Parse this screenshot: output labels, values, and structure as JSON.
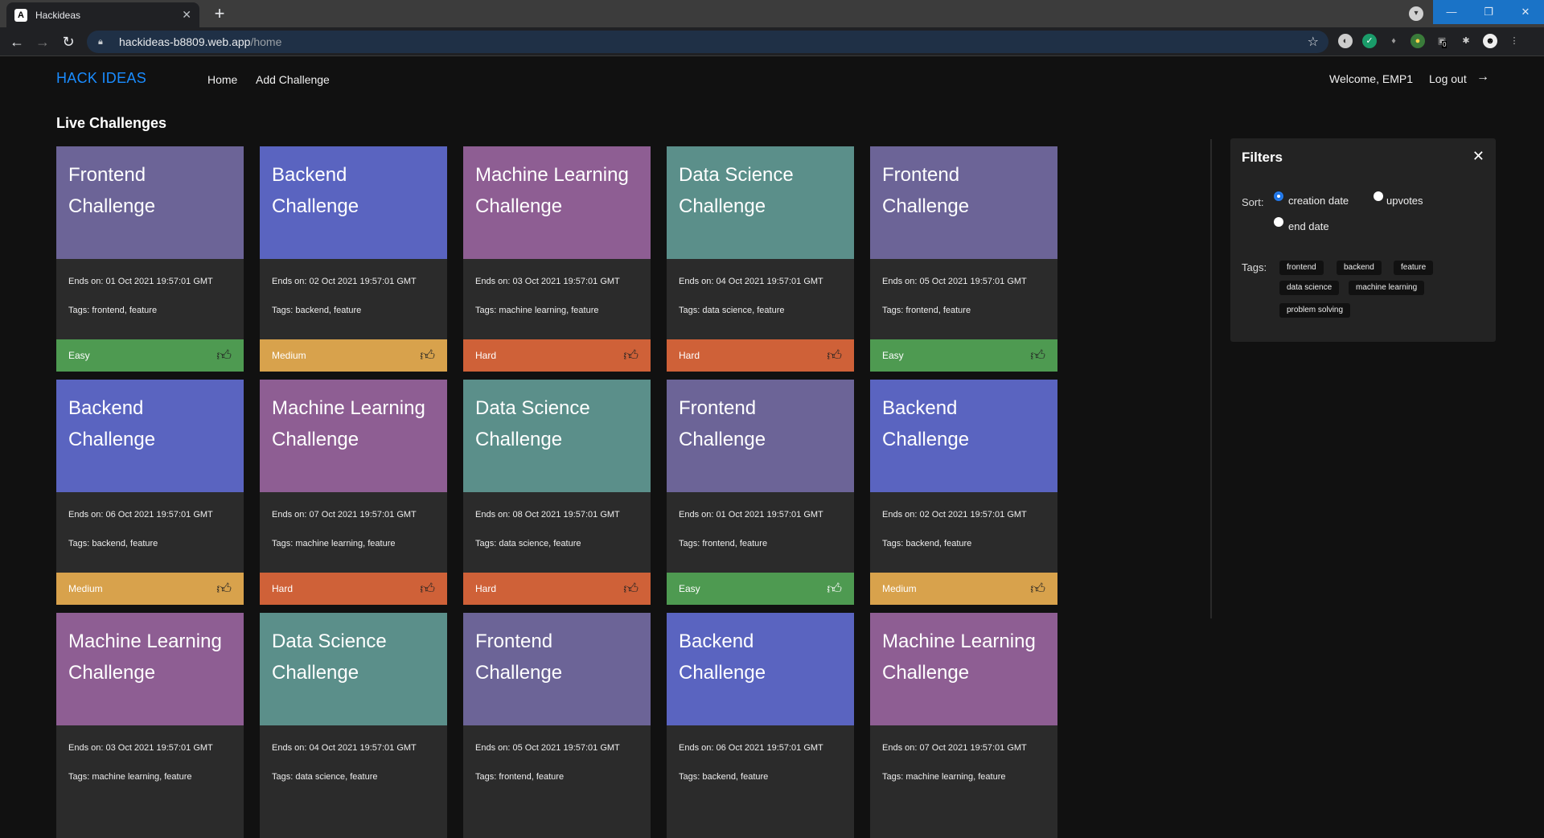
{
  "browser": {
    "tab_title": "Hackideas",
    "tab_favicon": "A",
    "url_host": "hackideas-b8809.web.app",
    "url_path": "/home",
    "ext_badge": "0"
  },
  "nav": {
    "brand": "HACK IDEAS",
    "home": "Home",
    "add_challenge": "Add Challenge",
    "welcome": "Welcome, EMP1",
    "logout": "Log out"
  },
  "section_title": "Live Challenges",
  "colors": {
    "frontend": "#6c6497",
    "backend": "#5a64c0",
    "machine_learning": "#8e5e93",
    "data_science": "#5b8f8a",
    "easy": "#4e9a51",
    "medium": "#d8a24c",
    "hard": "#cf6138"
  },
  "cards": [
    {
      "name": "Frontend Challenge",
      "cat": "frontend",
      "ends": "Ends on: 01 Oct 2021 19:57:01 GMT",
      "tags": "Tags: frontend, feature",
      "difficulty": "Easy",
      "level": "easy",
      "upvoted": false
    },
    {
      "name": "Backend Challenge",
      "cat": "backend",
      "ends": "Ends on: 02 Oct 2021 19:57:01 GMT",
      "tags": "Tags: backend, feature",
      "difficulty": "Medium",
      "level": "medium",
      "upvoted": false
    },
    {
      "name": "Machine Learning Challenge",
      "cat": "machine_learning",
      "ends": "Ends on: 03 Oct 2021 19:57:01 GMT",
      "tags": "Tags: machine learning, feature",
      "difficulty": "Hard",
      "level": "hard",
      "upvoted": false
    },
    {
      "name": "Data Science Challenge",
      "cat": "data_science",
      "ends": "Ends on: 04 Oct 2021 19:57:01 GMT",
      "tags": "Tags: data science, feature",
      "difficulty": "Hard",
      "level": "hard",
      "upvoted": false
    },
    {
      "name": "Frontend Challenge",
      "cat": "frontend",
      "ends": "Ends on: 05 Oct 2021 19:57:01 GMT",
      "tags": "Tags: frontend, feature",
      "difficulty": "Easy",
      "level": "easy",
      "upvoted": false
    },
    {
      "name": "Backend Challenge",
      "cat": "backend",
      "ends": "Ends on: 06 Oct 2021 19:57:01 GMT",
      "tags": "Tags: backend, feature",
      "difficulty": "Medium",
      "level": "medium",
      "upvoted": false
    },
    {
      "name": "Machine Learning Challenge",
      "cat": "machine_learning",
      "ends": "Ends on: 07 Oct 2021 19:57:01 GMT",
      "tags": "Tags: machine learning, feature",
      "difficulty": "Hard",
      "level": "hard",
      "upvoted": false
    },
    {
      "name": "Data Science Challenge",
      "cat": "data_science",
      "ends": "Ends on: 08 Oct 2021 19:57:01 GMT",
      "tags": "Tags: data science, feature",
      "difficulty": "Hard",
      "level": "hard",
      "upvoted": false
    },
    {
      "name": "Frontend Challenge",
      "cat": "frontend",
      "ends": "Ends on: 01 Oct 2021 19:57:01 GMT",
      "tags": "Tags: frontend, feature",
      "difficulty": "Easy",
      "level": "easy",
      "upvoted": true
    },
    {
      "name": "Backend Challenge",
      "cat": "backend",
      "ends": "Ends on: 02 Oct 2021 19:57:01 GMT",
      "tags": "Tags: backend, feature",
      "difficulty": "Medium",
      "level": "medium",
      "upvoted": false
    },
    {
      "name": "Machine Learning Challenge",
      "cat": "machine_learning",
      "ends": "Ends on: 03 Oct 2021 19:57:01 GMT",
      "tags": "Tags: machine learning, feature",
      "difficulty": "",
      "level": "",
      "upvoted": false
    },
    {
      "name": "Data Science Challenge",
      "cat": "data_science",
      "ends": "Ends on: 04 Oct 2021 19:57:01 GMT",
      "tags": "Tags: data science, feature",
      "difficulty": "",
      "level": "",
      "upvoted": false
    },
    {
      "name": "Frontend Challenge",
      "cat": "frontend",
      "ends": "Ends on: 05 Oct 2021 19:57:01 GMT",
      "tags": "Tags: frontend, feature",
      "difficulty": "",
      "level": "",
      "upvoted": false
    },
    {
      "name": "Backend Challenge",
      "cat": "backend",
      "ends": "Ends on: 06 Oct 2021 19:57:01 GMT",
      "tags": "Tags: backend, feature",
      "difficulty": "",
      "level": "",
      "upvoted": false
    },
    {
      "name": "Machine Learning Challenge",
      "cat": "machine_learning",
      "ends": "Ends on: 07 Oct 2021 19:57:01 GMT",
      "tags": "Tags: machine learning, feature",
      "difficulty": "",
      "level": "",
      "upvoted": false
    }
  ],
  "filters": {
    "title": "Filters",
    "sort_label": "Sort:",
    "sort_options": [
      {
        "label": "creation date",
        "checked": true
      },
      {
        "label": "upvotes",
        "checked": false
      },
      {
        "label": "end date",
        "checked": false
      }
    ],
    "tags_label": "Tags:",
    "tags": [
      "frontend",
      "backend",
      "feature",
      "data science",
      "machine learning",
      "problem solving"
    ]
  }
}
